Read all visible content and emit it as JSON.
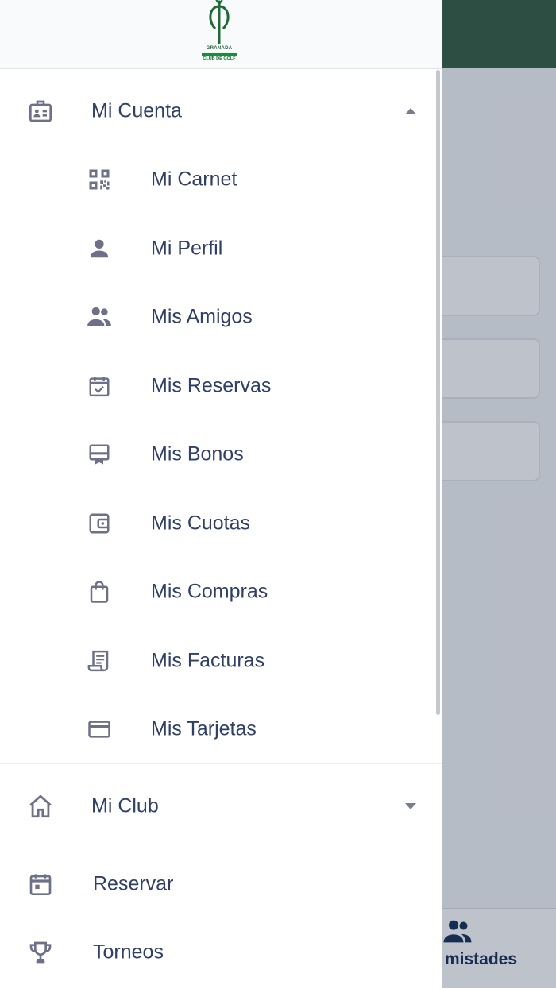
{
  "logo": {
    "line1": "GRANADA",
    "line2": "CLUB DE GOLF"
  },
  "menu": {
    "account": {
      "label": "Mi Cuenta",
      "icon": "id-card-icon",
      "expanded": true
    },
    "account_items": [
      {
        "label": "Mi Carnet",
        "icon": "qr-code-icon"
      },
      {
        "label": "Mi Perfil",
        "icon": "person-icon"
      },
      {
        "label": "Mis Amigos",
        "icon": "group-icon"
      },
      {
        "label": "Mis Reservas",
        "icon": "calendar-check-icon"
      },
      {
        "label": "Mis Bonos",
        "icon": "voucher-icon"
      },
      {
        "label": "Mis Cuotas",
        "icon": "wallet-icon"
      },
      {
        "label": "Mis Compras",
        "icon": "shopping-bag-icon"
      },
      {
        "label": "Mis Facturas",
        "icon": "receipt-icon"
      },
      {
        "label": "Mis Tarjetas",
        "icon": "credit-card-icon"
      }
    ],
    "club": {
      "label": "Mi Club",
      "icon": "home-icon",
      "expanded": false
    },
    "extra_items": [
      {
        "label": "Reservar",
        "icon": "calendar-icon"
      },
      {
        "label": "Torneos",
        "icon": "trophy-icon"
      }
    ]
  },
  "background": {
    "bottom_tab_label": "mistades"
  },
  "colors": {
    "header_green": "#2e5a3e",
    "text": "#2f3f66",
    "icon": "#6e7088"
  }
}
